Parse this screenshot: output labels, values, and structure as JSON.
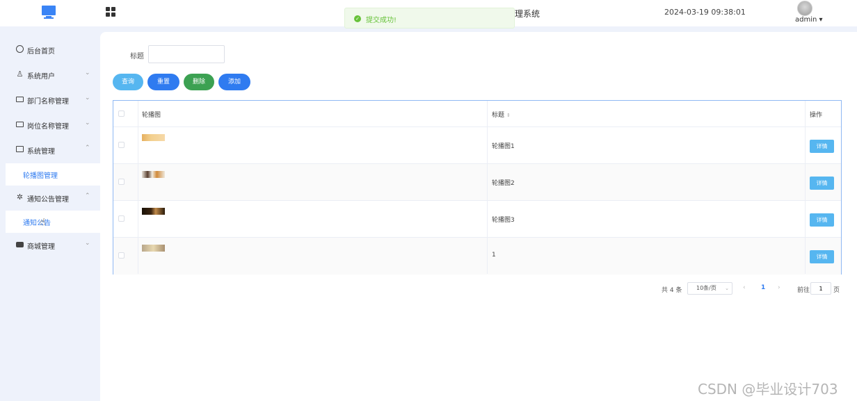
{
  "header": {
    "title_fragment": "理系统",
    "datetime": "2024-03-19 09:38:01",
    "username": "admin",
    "username_arrow": "▾"
  },
  "toast": {
    "message": "提交成功!",
    "icon": "check-circle-icon",
    "color": "#67c23a"
  },
  "sidebar": {
    "items": [
      {
        "label": "后台首页",
        "icon": "clock-icon",
        "arrow": ""
      },
      {
        "label": "系统用户",
        "icon": "user-icon",
        "arrow": "⌄"
      },
      {
        "label": "部门名称管理",
        "icon": "id-card-icon",
        "arrow": "⌄"
      },
      {
        "label": "岗位名称管理",
        "icon": "id-card-icon",
        "arrow": "⌄"
      },
      {
        "label": "系统管理",
        "icon": "folder-icon",
        "arrow": "⌃"
      },
      {
        "label": "轮播图管理",
        "icon": "",
        "arrow": ""
      },
      {
        "label": "通知公告管理",
        "icon": "loading-icon",
        "arrow": "⌃"
      },
      {
        "label": "通知公告",
        "icon": "",
        "arrow": ""
      },
      {
        "label": "商城管理",
        "icon": "shop-icon",
        "arrow": "⌄"
      }
    ]
  },
  "filter": {
    "label": "标题",
    "value": ""
  },
  "buttons": {
    "search": "查询",
    "reset": "重置",
    "delete": "删除",
    "add": "添加"
  },
  "table": {
    "headers": [
      "轮播图",
      "标题",
      "操作"
    ],
    "sort_icon": "⇕",
    "rows": [
      {
        "title": "轮播图1",
        "action": "详情"
      },
      {
        "title": "轮播图2",
        "action": "详情"
      },
      {
        "title": "轮播图3",
        "action": "详情"
      },
      {
        "title": "1",
        "action": "详情"
      }
    ]
  },
  "pagination": {
    "total": "共 4 条",
    "page_size": "10条/页",
    "prev": "‹",
    "current": "1",
    "next": "›",
    "goto_label": "前往",
    "goto_value": "1",
    "unit": "页"
  },
  "watermark": "CSDN @毕业设计703",
  "colors": {
    "primary": "#2f7bf0",
    "info": "#56b6f0",
    "success": "#3ca152",
    "sidebar_bg": "#eef2fb"
  }
}
